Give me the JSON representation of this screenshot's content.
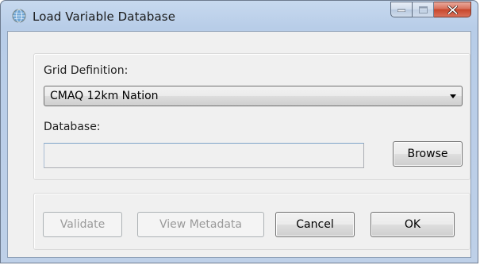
{
  "window": {
    "title": "Load Variable Database",
    "app_icon": "globe-icon",
    "controls": {
      "minimize_icon": "minimize-icon",
      "maximize_icon": "maximize-icon",
      "close_icon": "close-icon"
    }
  },
  "grid": {
    "label": "Grid Definition:",
    "selected": "CMAQ 12km Nation"
  },
  "database": {
    "label": "Database:",
    "value": "",
    "browse_label": "Browse"
  },
  "actions": {
    "validate_label": "Validate",
    "metadata_label": "View Metadata",
    "cancel_label": "Cancel",
    "ok_label": "OK"
  },
  "colors": {
    "close_button": "#c7462b",
    "disabled_text": "#9a9a9a"
  }
}
